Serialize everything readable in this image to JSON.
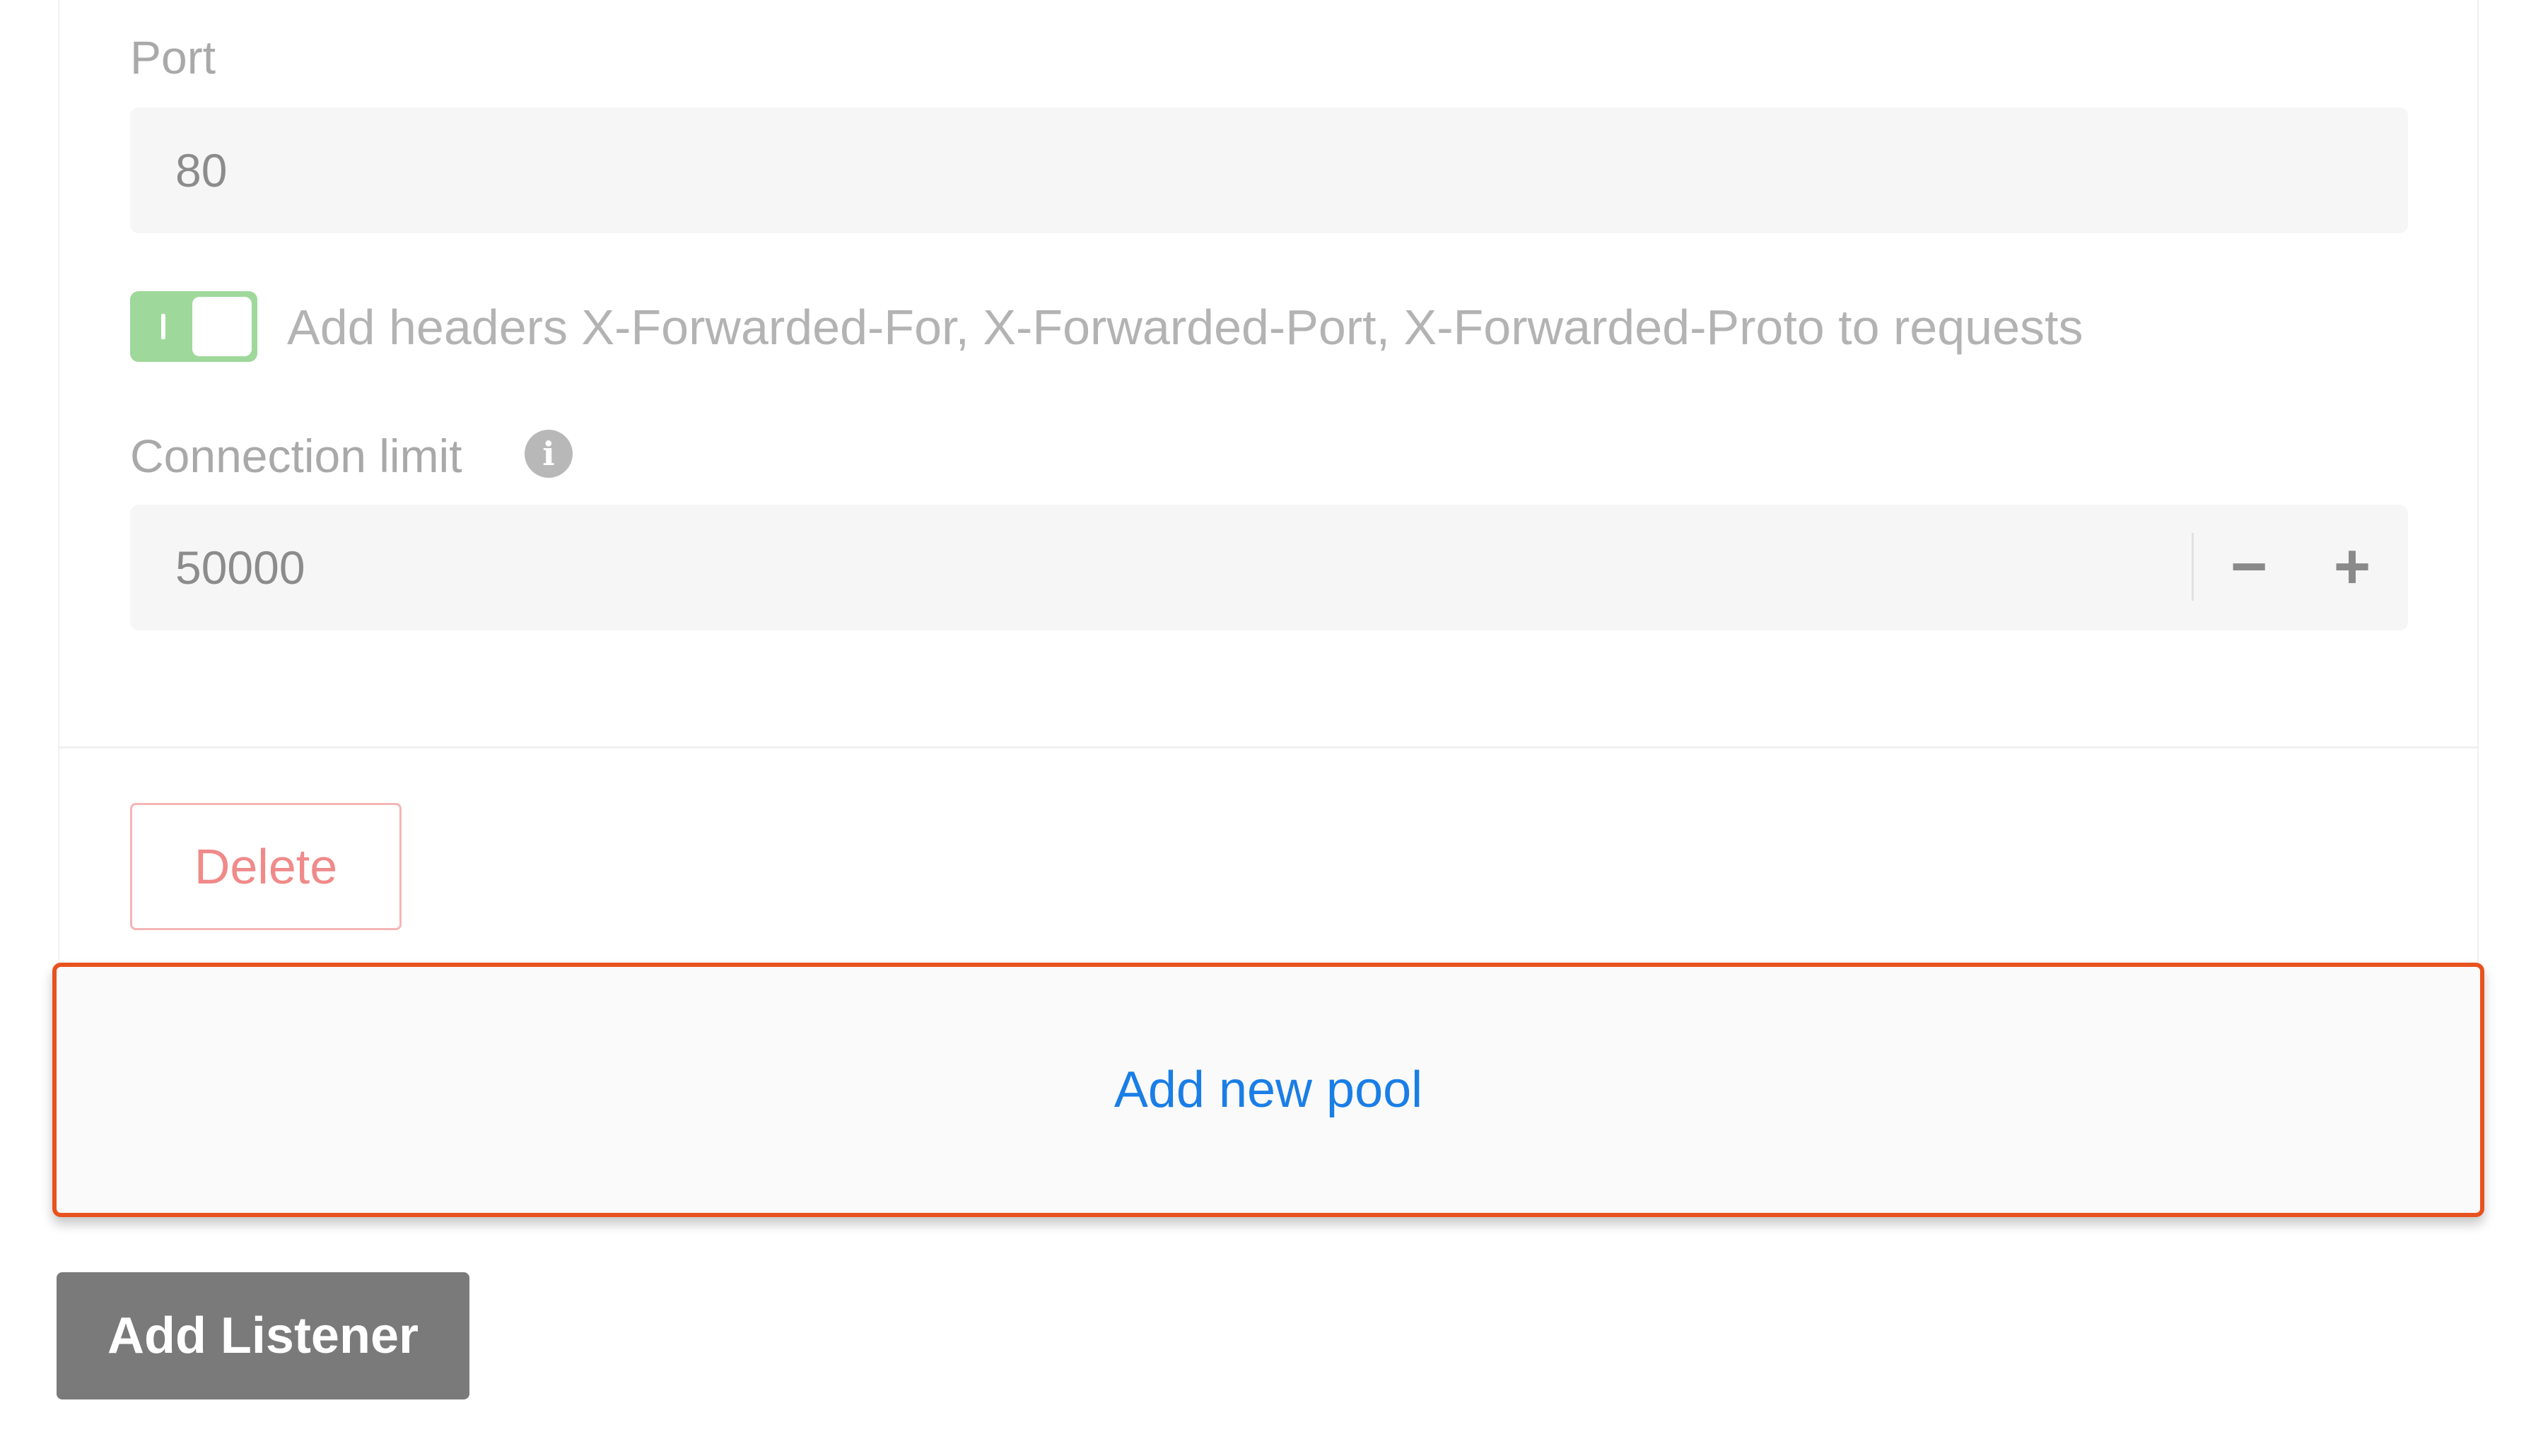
{
  "port": {
    "label": "Port",
    "value": "80"
  },
  "forwarded_headers": {
    "enabled": true,
    "label": "Add headers X-Forwarded-For, X-Forwarded-Port, X-Forwarded-Proto to requests"
  },
  "connection_limit": {
    "label": "Connection limit",
    "value": "50000",
    "decrement_label": "−",
    "increment_label": "+",
    "info_icon": "i"
  },
  "actions": {
    "delete_label": "Delete",
    "add_pool_label": "Add new pool",
    "add_listener_label": "Add Listener"
  },
  "colors": {
    "toggle_on": "#9ed89a",
    "delete": "#f08a8a",
    "add_pool_text": "#1a7ee6",
    "highlight_border": "#e8521e",
    "add_listener_bg": "#7a7a7a"
  },
  "icons": {
    "info": "info-icon",
    "minus": "minus-icon",
    "plus": "plus-icon"
  }
}
